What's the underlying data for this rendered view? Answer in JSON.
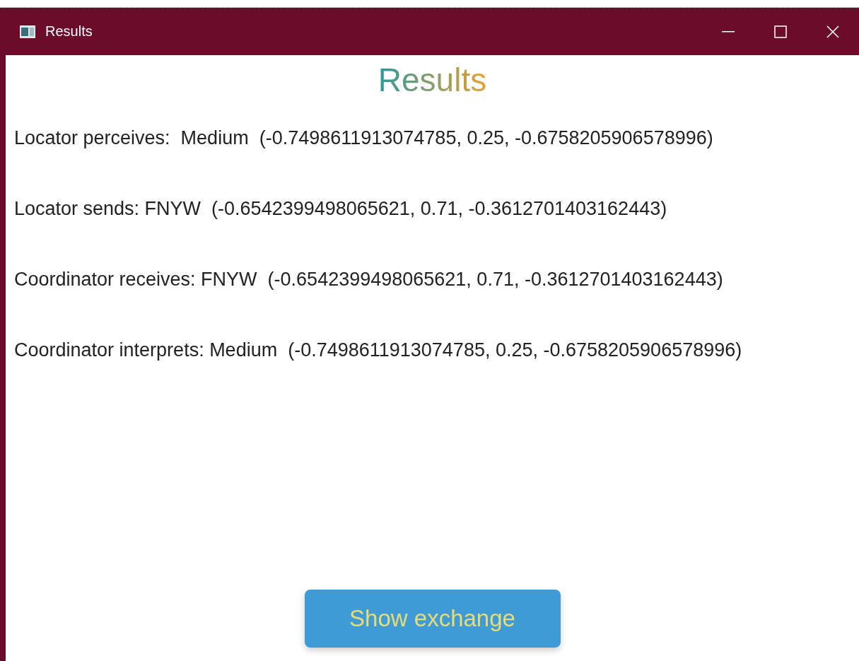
{
  "window": {
    "title": "Results"
  },
  "heading": "Results",
  "lines": [
    "Locator perceives:  Medium  (-0.7498611913074785, 0.25, -0.6758205906578996)",
    "Locator sends: FNYW  (-0.6542399498065621, 0.71, -0.3612701403162443)",
    "Coordinator receives: FNYW  (-0.6542399498065621, 0.71, -0.3612701403162443)",
    "Coordinator interprets: Medium  (-0.7498611913074785, 0.25, -0.6758205906578996)"
  ],
  "button": "Show exchange"
}
